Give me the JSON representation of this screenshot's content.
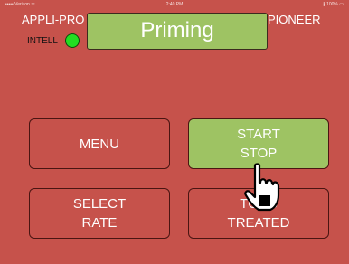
{
  "status_bar": {
    "carrier": "••••• Verizon ᯤ",
    "time": "2:40 PM",
    "battery": "∦ 100% ▭"
  },
  "header": {
    "brand_left": "APPLI-PRO",
    "intell_label": "INTELL",
    "indicator_color": "#22dd22",
    "status_text": "Priming",
    "brand_right": "PIONEER"
  },
  "buttons": {
    "menu": {
      "label": "MENU"
    },
    "start_stop": {
      "line1": "START",
      "line2": "STOP"
    },
    "select_rate": {
      "line1": "SELECT",
      "line2": "RATE"
    },
    "tons_treated": {
      "line1": "TONS",
      "line2": "TREATED"
    }
  },
  "colors": {
    "background": "#c6524b",
    "accent_green": "#9ec363",
    "text": "#ffffff"
  },
  "icons": {
    "cursor": "hand-pointer-icon"
  }
}
